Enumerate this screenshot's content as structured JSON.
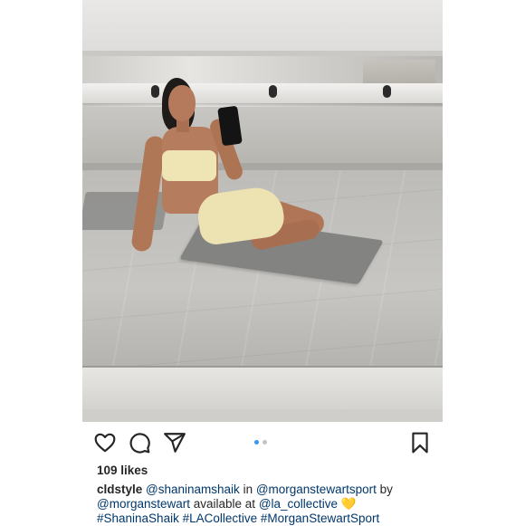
{
  "post": {
    "photo": {
      "description_icon": "photo-gym-mirror-selfie"
    },
    "actions": {
      "like_icon": "heart-icon",
      "comment_icon": "comment-icon",
      "share_icon": "send-icon",
      "save_icon": "bookmark-icon",
      "carousel": {
        "count": 2,
        "active_index": 0,
        "active_color": "#3897f0",
        "inactive_color": "#c4c4c4"
      }
    },
    "likes_text": "109 likes",
    "caption": {
      "username": "cldstyle",
      "mention_1": "@shaninamshaik",
      "word_in": " in ",
      "mention_2": "@morganstewartsport",
      "word_by": " by",
      "mention_3": "@morganstewart",
      "word_available": " available at ",
      "mention_4": "@la_collective",
      "emoji": "💛",
      "hashtag_1": "#ShaninaShaik",
      "hashtag_2": "#LACollective",
      "hashtag_3": "#MorganStewartSport"
    }
  }
}
